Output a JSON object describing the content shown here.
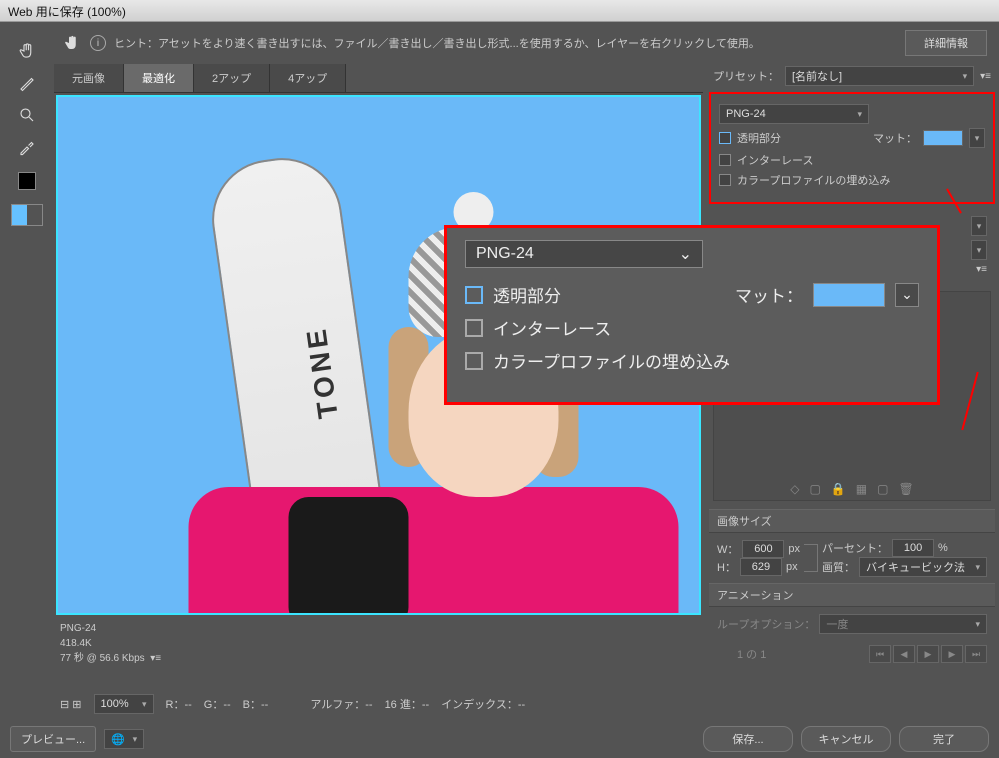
{
  "title": "Web 用に保存 (100%)",
  "hint": "ヒント：アセットをより速く書き出すには、ファイル／書き出し／書き出し形式...を使用するか、レイヤーを右クリックして使用。",
  "details_btn": "詳細情報",
  "tabs": {
    "original": "元画像",
    "optimized": "最適化",
    "two_up": "2アップ",
    "four_up": "4アップ"
  },
  "preview_info": {
    "format": "PNG-24",
    "size": "418.4K",
    "time": "77 秒 @ 56.6 Kbps"
  },
  "preset_label": "プリセット：",
  "preset_value": "[名前なし]",
  "format_value": "PNG-24",
  "opts": {
    "transparency": "透明部分",
    "interlaced": "インターレース",
    "embed_profile": "カラープロファイルの埋め込み"
  },
  "matte_label": "マット：",
  "image_size_label": "画像サイズ",
  "w_label": "W：",
  "w_value": "600",
  "h_label": "H：",
  "h_value": "629",
  "px": "px",
  "percent_label": "パーセント：",
  "percent_value": "100",
  "percent_unit": "%",
  "quality_label": "画質：",
  "quality_value": "バイキュービック法",
  "animation_label": "アニメーション",
  "loop_label": "ループオプション：",
  "loop_value": "一度",
  "frame_info": "1 の 1",
  "status": {
    "zoom": "100%",
    "r": "R：--",
    "g": "G：--",
    "b": "B：--",
    "alpha": "アルファ：--",
    "hex": "16 進：--",
    "index": "インデックス：--"
  },
  "footer": {
    "preview": "プレビュー...",
    "save": "保存...",
    "cancel": "キャンセル",
    "done": "完了"
  },
  "callout": {
    "format": "PNG-24",
    "transparency": "透明部分",
    "interlaced": "インターレース",
    "embed_profile": "カラープロファイルの埋め込み",
    "matte": "マット："
  }
}
